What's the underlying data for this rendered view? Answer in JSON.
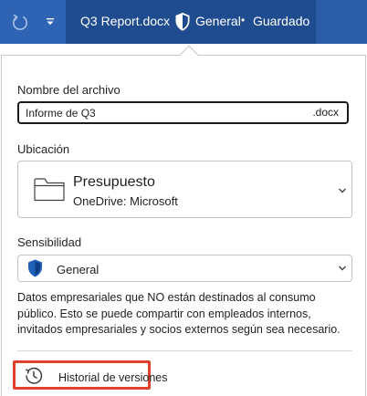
{
  "titlebar": {
    "document_title": "Q3 Report.docx",
    "sensitivity": "General",
    "separator": "•",
    "save_status": "Guardado",
    "undo_icon": "undo-icon",
    "qat_icon": "chevron-down-icon"
  },
  "file_name": {
    "label": "Nombre del archivo",
    "value": "Informe de Q3",
    "extension": ".docx"
  },
  "location": {
    "label": "Ubicación",
    "folder_name": "Presupuesto",
    "path": "OneDrive: Microsoft",
    "icon": "folder-icon"
  },
  "sensitivity": {
    "label": "Sensibilidad",
    "selected": "General",
    "icon": "shield-icon",
    "description": "Datos empresariales que NO están destinados al consumo público. Esto se puede compartir con empleados internos, invitados empresariales y socios externos según sea necesario."
  },
  "version_history": {
    "label": "Historial de versiones",
    "icon": "history-icon"
  },
  "colors": {
    "titlebar": "#2b5ca8",
    "titlebar_dark": "#1f4b8f",
    "shield": "#1f5fb8",
    "highlight": "#e0402e"
  }
}
